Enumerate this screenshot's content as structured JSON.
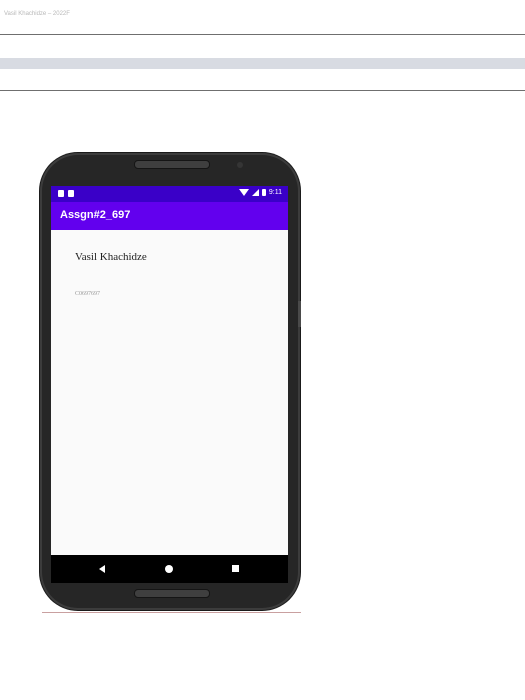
{
  "document": {
    "header_text": "Vasil Khachidze – 2022F"
  },
  "phone": {
    "status_bar": {
      "time": "9:11",
      "background_color": "#3a00c8",
      "icons": [
        "notification-icon",
        "sim-icon",
        "wifi-icon",
        "signal-icon",
        "battery-icon"
      ]
    },
    "app_bar": {
      "title": "Assgn#2_697",
      "background_color": "#6200ee"
    },
    "content": {
      "name": "Vasil Khachidze",
      "id": "C0697697"
    },
    "nav_bar": {
      "icons": [
        "back-icon",
        "home-icon",
        "recents-icon"
      ]
    }
  }
}
